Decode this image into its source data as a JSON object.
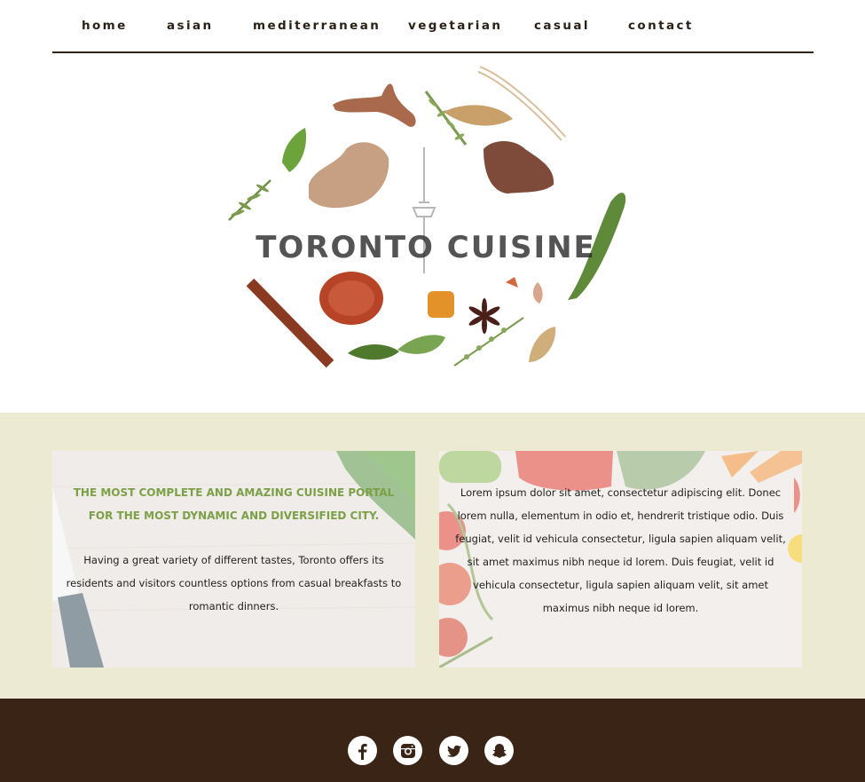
{
  "nav": {
    "items": [
      {
        "label": "home"
      },
      {
        "label": "asian"
      },
      {
        "label": "mediterranean"
      },
      {
        "label": "vegetarian"
      },
      {
        "label": "casual"
      },
      {
        "label": "contact"
      }
    ]
  },
  "hero": {
    "logo_text": "TORONTO CUISINE"
  },
  "cards": {
    "left": {
      "title": "THE MOST COMPLETE AND AMAZING CUISINE PORTAL FOR THE MOST DYNAMIC AND DIVERSIFIED CITY.",
      "body": "Having a great variety of different tastes, Toronto offers its residents and visitors countless options from casual breakfasts to romantic dinners."
    },
    "right": {
      "body": "Lorem ipsum dolor sit amet, consectetur adipiscing elit. Donec lorem nulla, elementum in odio et, hendrerit tristique odio. Duis feugiat, velit id vehicula consectetur, ligula sapien aliquam velit, sit amet maximus nibh neque id lorem. Duis feugiat, velit id vehicula consectetur, ligula sapien aliquam velit, sit amet maximus nibh neque id lorem."
    }
  },
  "footer": {
    "social": [
      {
        "icon": "facebook-icon"
      },
      {
        "icon": "instagram-icon"
      },
      {
        "icon": "twitter-icon"
      },
      {
        "icon": "snapchat-icon"
      }
    ]
  },
  "colors": {
    "nav_text": "#2b2016",
    "band_bg": "#ecead3",
    "accent_green": "#7ba046",
    "footer_bg": "#3a2416"
  }
}
